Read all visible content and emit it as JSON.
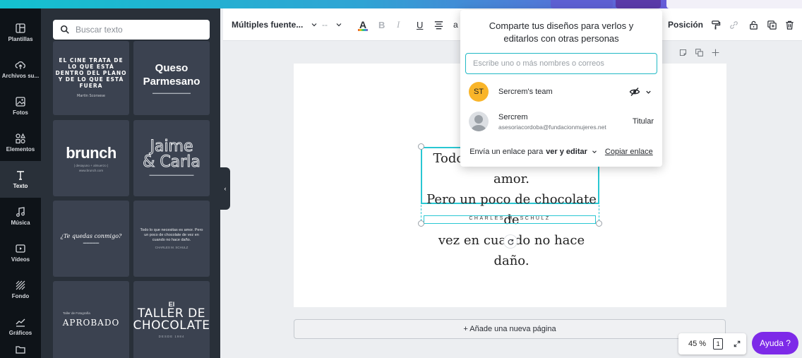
{
  "colors": {
    "rail_bg": "#0e1318",
    "panel_bg": "#293039",
    "tile_bg": "#3b4250",
    "accent_cyan": "#29c7d3",
    "help_purple": "#7d2ae8",
    "team_avatar": "#f9b529"
  },
  "rail": {
    "items": [
      {
        "label": "Plantillas",
        "icon": "templates-icon"
      },
      {
        "label": "Archivos su...",
        "icon": "upload-cloud-icon"
      },
      {
        "label": "Fotos",
        "icon": "photo-icon"
      },
      {
        "label": "Elementos",
        "icon": "elements-icon"
      },
      {
        "label": "Texto",
        "icon": "text-icon"
      },
      {
        "label": "Música",
        "icon": "music-icon"
      },
      {
        "label": "Vídeos",
        "icon": "video-icon"
      },
      {
        "label": "Fondo",
        "icon": "background-icon"
      },
      {
        "label": "Gráficos",
        "icon": "chart-icon"
      }
    ]
  },
  "panel": {
    "search_placeholder": "Buscar texto",
    "tiles": {
      "cine": {
        "lines": [
          "EL CINE TRATA DE",
          "LO QUE ESTÁ",
          "DENTRO DEL PLANO",
          "Y DE LO QUE ESTÁ",
          "FUERA"
        ],
        "sub": "Martin Scorsese"
      },
      "queso": {
        "line1": "Queso",
        "line2": "Parmesano"
      },
      "brunch": {
        "title": "brunch",
        "sub1": "| desayuno + almuerzo |",
        "sub2": "www.brunch.com"
      },
      "jaime": {
        "line1": "Jaime",
        "line2": "& Carla"
      },
      "quedas": {
        "title": "¿Te quedas conmigo?"
      },
      "todo_small": {
        "text": "Todo lo que necesitas es amor. Pero un poco de chocolate de vez en cuando no hace daño.",
        "author": "CHARLES M. SCHULZ"
      },
      "aprobado": {
        "sub": "Taller de Fotografía",
        "title": "APROBADO"
      },
      "taller": {
        "line1": "El",
        "line2": "TALLER DE",
        "line3": "CHOCOLATE",
        "sub": "DESDE 1984"
      }
    }
  },
  "toolbar": {
    "font_name": "Múltiples fuente...",
    "size_placeholder": "--",
    "text_color_letter": "A",
    "bold": "B",
    "italic": "I",
    "underline": "U",
    "partial": "a",
    "position": "Posición"
  },
  "canvas": {
    "quote_lines": [
      "Todo lo que necesitas es amor.",
      "Pero un poco de chocolate de",
      "vez en cuando no hace daño."
    ],
    "author": "CHARLES M. SCHULZ",
    "add_page": "+ Añade una nueva página"
  },
  "footer": {
    "zoom": "45 %",
    "page_number": "1",
    "help": "Ayuda ?"
  },
  "share": {
    "title": "Comparte tus diseños para verlos y editarlos con otras personas",
    "input_placeholder": "Escribe uno o más nombres o correos",
    "team": {
      "initials": "ST",
      "name": "Sercrem's team"
    },
    "owner": {
      "name": "Sercrem",
      "email": "asesoriacordoba@fundacionmujeres.net",
      "role": "Titular"
    },
    "link_prefix": "Envía un enlace para",
    "link_mode": "ver y editar",
    "copy_link": "Copiar enlace"
  }
}
